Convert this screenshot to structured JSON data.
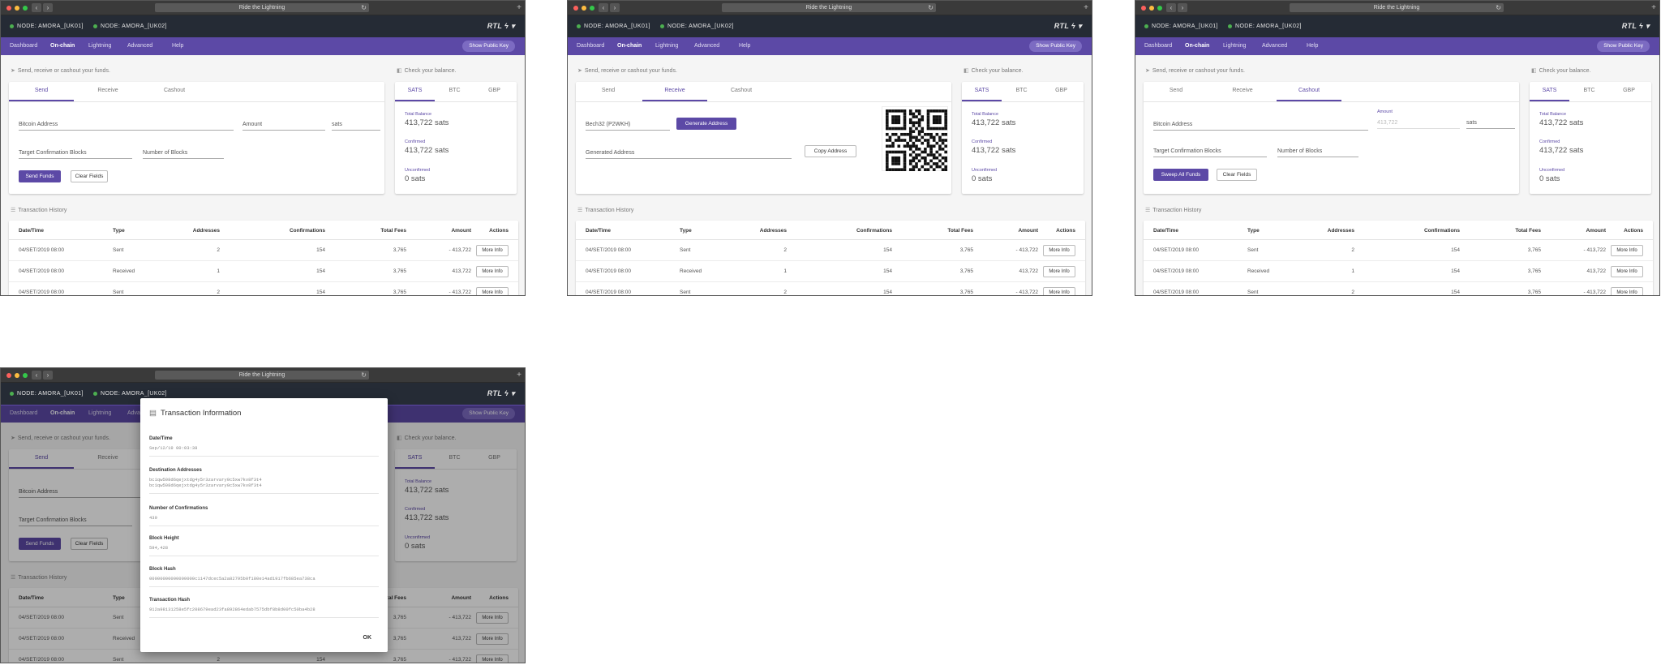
{
  "browser": {
    "url": "Ride the Lightning",
    "reload": "↻",
    "plus": "+"
  },
  "nodes": {
    "node1": "NODE: AMORA_[UK01]",
    "node2": "NODE: AMORA_[UK02]",
    "logo": "RTL ϟ ▾"
  },
  "menu": {
    "items": [
      "Dashboard",
      "On-chain",
      "Lightning",
      "Advanced",
      "Help"
    ],
    "public_key": "Show Public Key"
  },
  "hints": {
    "send": "Send, receive or cashout your funds.",
    "balance": "Check your balance.",
    "history": "Transaction History"
  },
  "tabs": [
    "Send",
    "Receive",
    "Cashout"
  ],
  "balance_tabs": [
    "SATS",
    "BTC",
    "GBP"
  ],
  "send_form": {
    "address": "Bitcoin Address",
    "amount": "Amount",
    "unit": "sats",
    "target": "Target Confirmation Blocks",
    "blocks": "Number of Blocks",
    "send_btn": "Send Funds",
    "clear_btn": "Clear Fields"
  },
  "receive_form": {
    "addr_type": "Bech32 (P2WKH)",
    "generate": "Generate Address",
    "generated": "Generated Address",
    "copy": "Copy Address"
  },
  "cashout_form": {
    "amount_label": "Amount",
    "amount_value": "413,722",
    "sweep": "Sweep All Funds"
  },
  "balance": {
    "total_label": "Total Balance",
    "total": "413,722 sats",
    "confirmed_label": "Confirmed",
    "confirmed": "413,722 sats",
    "unconfirmed_label": "Unconfirmed",
    "unconfirmed": "0 sats"
  },
  "table": {
    "headers": [
      "Date/Time",
      "Type",
      "Addresses",
      "Confirmations",
      "Total Fees",
      "Amount",
      "Actions"
    ],
    "rows": [
      [
        "04/SET/2019 08:00",
        "Sent",
        "2",
        "154",
        "3,765",
        "- 413,722"
      ],
      [
        "04/SET/2019 08:00",
        "Received",
        "1",
        "154",
        "3,765",
        "413,722"
      ],
      [
        "04/SET/2019 08:00",
        "Sent",
        "2",
        "154",
        "3,765",
        "- 413,722"
      ]
    ],
    "action": "More Info"
  },
  "dialog": {
    "title": "Transaction Information",
    "date_label": "Date/Time",
    "date": "Sep/12/19 00:03:38",
    "dest_label": "Destination Addresses",
    "dest1": "bc1qw508d6qejxtdg4y5r3zarvary0c5xw7kv8f3t4",
    "dest2": "bc1qw508d6qejxtdg4y5r3zarvary0c5xw7kv8f3t4",
    "conf_label": "Number of Confirmations",
    "conf": "439",
    "height_label": "Block Height",
    "height": "594,428",
    "hash_label": "Block Hash",
    "hash": "00000000000000000c1147dcec5a2a82795b0f180e14ad1917fb685ea738ca",
    "tx_label": "Transaction Hash",
    "tx": "912a98131258e5fc208679ead23fa892864edab7575dbf8b8d00fc50ba4b28",
    "ok": "OK"
  }
}
